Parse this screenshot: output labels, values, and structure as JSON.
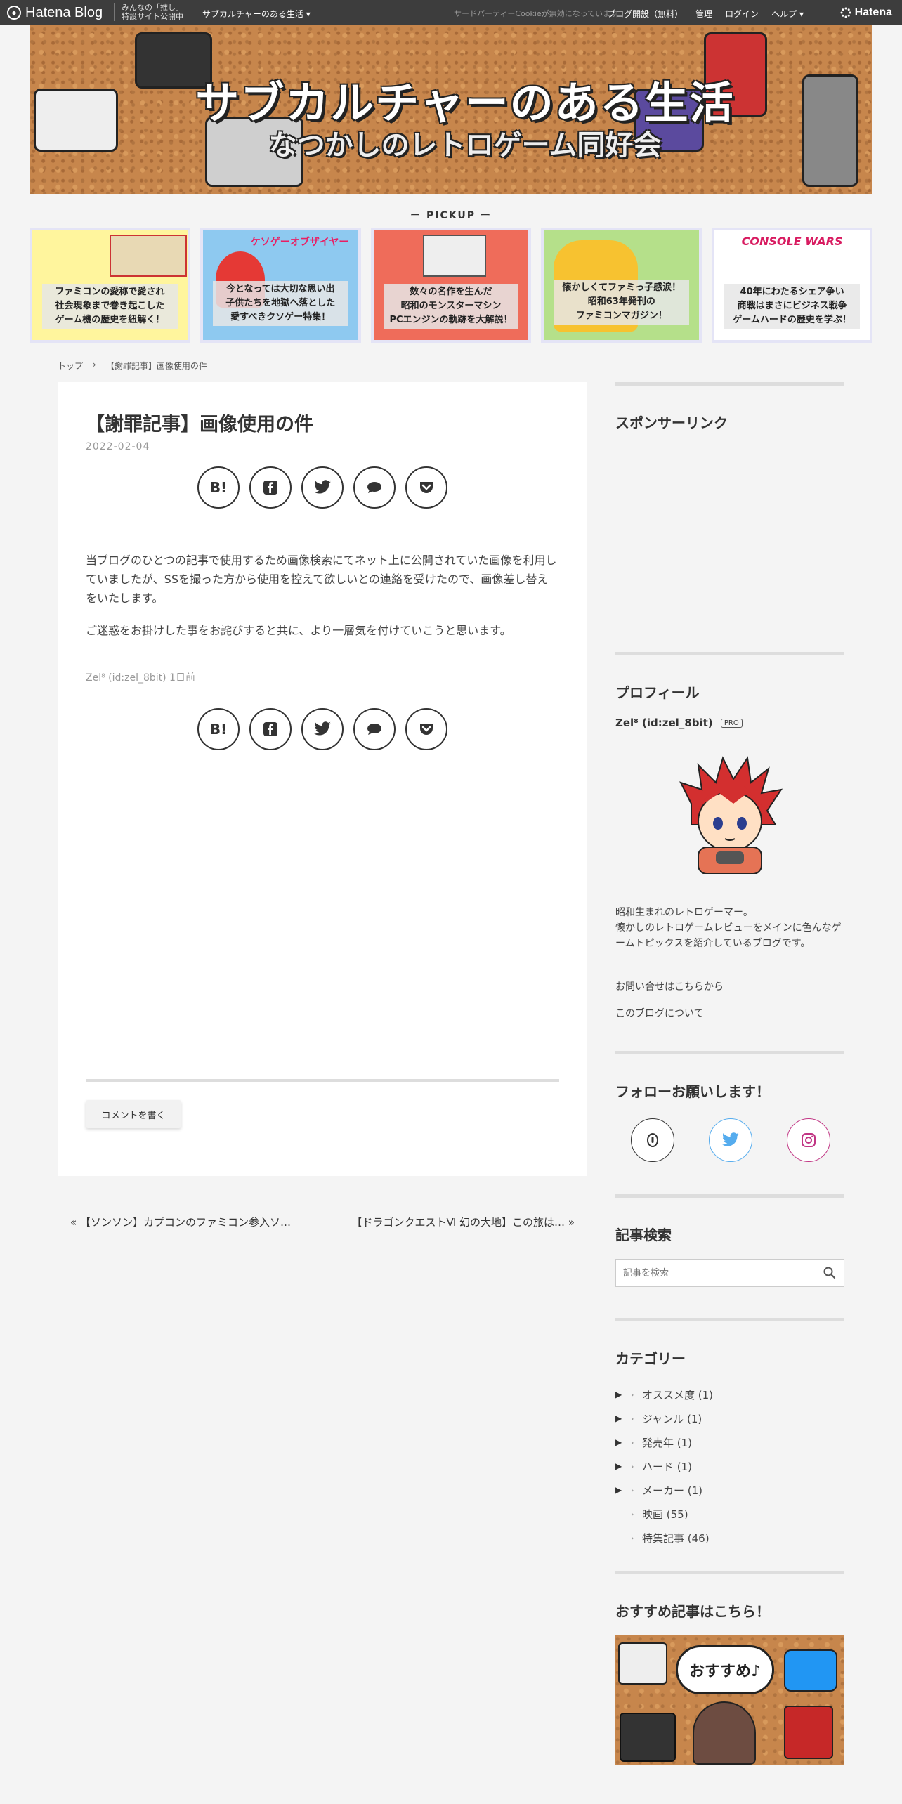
{
  "topbar": {
    "brand": "Hatena Blog",
    "promo_line1": "みんなの「推し」",
    "promo_line2": "特設サイト公開中",
    "blog_menu": "サブカルチャーのある生活 ▾",
    "cookie_notice": "サードパーティーCookieが無効になっています",
    "nav": [
      "ブログ開設（無料）",
      "管理",
      "ログイン",
      "ヘルプ ▾"
    ],
    "hatena": "Hatena"
  },
  "header": {
    "title": "サブカルチャーのある生活",
    "subtitle": "なつかしのレトロゲーム同好会"
  },
  "pickup": {
    "label": "ー PICKUP ー",
    "items": [
      {
        "caption": "ファミコンの愛称で愛され\n社会現象まで巻き起こした\nゲーム機の歴史を紐解く！",
        "bg": "#fff59d",
        "top_text": ""
      },
      {
        "caption": "今となっては大切な思い出\n子供たちを地獄へ落とした\n愛すべきクソゲー特集！",
        "bg": "#8ec9f0",
        "top_text": "ケソゲーオブザイヤー"
      },
      {
        "caption": "数々の名作を生んだ\n昭和のモンスターマシン\nPCエンジンの軌跡を大解説！",
        "bg": "#ef6c5a",
        "top_text": ""
      },
      {
        "caption": "懐かしくてファミっ子感涙！\n昭和63年発刊の\nファミコンマガジン！",
        "bg": "#b5e08a",
        "top_text": ""
      },
      {
        "caption": "40年にわたるシェア争い\n商戦はまさにビジネス戦争\nゲームハードの歴史を学ぶ！",
        "bg": "#ffffff",
        "top_text": "CONSOLE WARS"
      }
    ]
  },
  "breadcrumb": {
    "home": "トップ",
    "sep": "›",
    "current": "【謝罪記事】画像使用の件"
  },
  "article": {
    "title": "【謝罪記事】画像使用の件",
    "date": "2022-02-04",
    "paragraph1": "当ブログのひとつの記事で使用するため画像検索にてネット上に公開されていた画像を利用していましたが、SSを撮った方から使用を控えて欲しいとの連絡を受けたので、画像差し替えをいたします。",
    "paragraph2": "ご迷惑をお掛けした事をお詫びすると共に、より一層気を付けていこうと思います。",
    "author": "Zel⁸ (id:zel_8bit) 1日前",
    "share": [
      "B!",
      "f",
      "twitter",
      "comment",
      "pocket"
    ],
    "comment_button": "コメントを書く"
  },
  "pager": {
    "prev": "« 【ソンソン】カプコンのファミコン参入ソ…",
    "next": "【ドラゴンクエストⅥ 幻の大地】この旅は… »"
  },
  "sidebar": {
    "sponsor_title": "スポンサーリンク",
    "profile_title": "プロフィール",
    "profile_name": "Zel⁸ (id:zel_8bit)",
    "pro_badge": "PRO",
    "profile_desc": "昭和生まれのレトロゲーマー。\n懐かしのレトロゲームレビューをメインに色んなゲームトピックスを紹介しているブログです。",
    "contact_link": "お問い合せはこちらから",
    "about_link": "このブログについて",
    "follow_title": "フォローお願いします！",
    "follow_colors": {
      "hatena": "#333333",
      "twitter": "#55acee",
      "instagram": "#c13584"
    },
    "search_title": "記事検索",
    "search_placeholder": "記事を検索",
    "category_title": "カテゴリー",
    "categories": [
      {
        "label": "オススメ度 (1)",
        "expandable": true
      },
      {
        "label": "ジャンル (1)",
        "expandable": true
      },
      {
        "label": "発売年 (1)",
        "expandable": true
      },
      {
        "label": "ハード (1)",
        "expandable": true
      },
      {
        "label": "メーカー (1)",
        "expandable": true
      },
      {
        "label": "映画 (55)",
        "expandable": false
      },
      {
        "label": "特集記事 (46)",
        "expandable": false
      }
    ],
    "recommend_title": "おすすめ記事はこちら！",
    "recommend_bubble": "おすすめ♪"
  }
}
